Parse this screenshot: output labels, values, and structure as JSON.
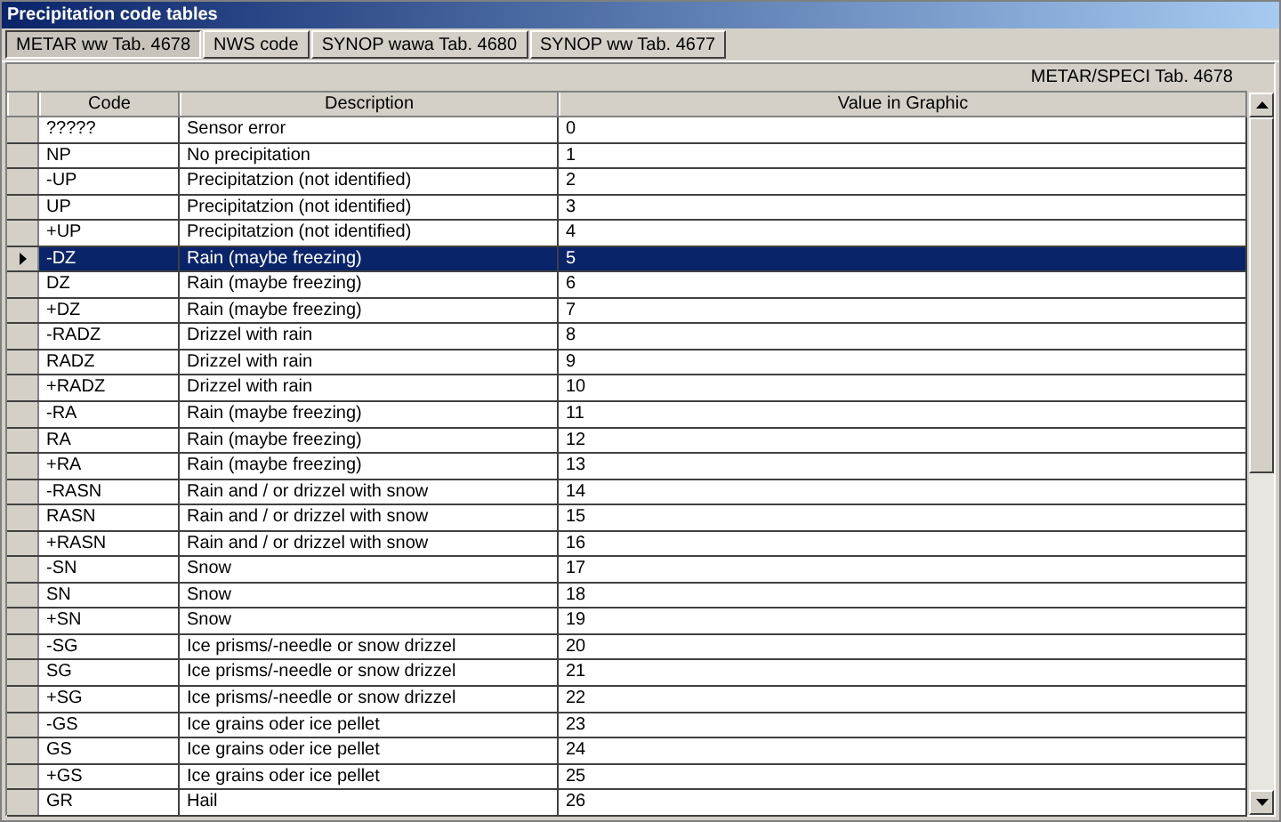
{
  "window": {
    "title": "Precipitation code tables"
  },
  "tabs": [
    {
      "label": "METAR ww Tab. 4678",
      "selected": true
    },
    {
      "label": "NWS code",
      "selected": false
    },
    {
      "label": "SYNOP wawa Tab. 4680",
      "selected": false
    },
    {
      "label": "SYNOP ww Tab. 4677",
      "selected": false
    }
  ],
  "table": {
    "caption": "METAR/SPECI Tab. 4678",
    "columns": [
      "Code",
      "Description",
      "Value in Graphic"
    ],
    "rows": [
      {
        "cells": [
          "?????",
          "Sensor error",
          "0"
        ],
        "selected": false
      },
      {
        "cells": [
          "NP",
          "No precipitation",
          "1"
        ],
        "selected": false
      },
      {
        "cells": [
          "-UP",
          "Precipitatzion (not identified)",
          "2"
        ],
        "selected": false
      },
      {
        "cells": [
          "UP",
          "Precipitatzion (not identified)",
          "3"
        ],
        "selected": false
      },
      {
        "cells": [
          "+UP",
          "Precipitatzion (not identified)",
          "4"
        ],
        "selected": false
      },
      {
        "cells": [
          "-DZ",
          "Rain (maybe freezing)",
          "5"
        ],
        "selected": true
      },
      {
        "cells": [
          "DZ",
          "Rain (maybe freezing)",
          "6"
        ],
        "selected": false
      },
      {
        "cells": [
          "+DZ",
          "Rain (maybe freezing)",
          "7"
        ],
        "selected": false
      },
      {
        "cells": [
          "-RADZ",
          "Drizzel with rain",
          "8"
        ],
        "selected": false
      },
      {
        "cells": [
          "RADZ",
          "Drizzel with rain",
          "9"
        ],
        "selected": false
      },
      {
        "cells": [
          "+RADZ",
          "Drizzel with rain",
          "10"
        ],
        "selected": false
      },
      {
        "cells": [
          "-RA",
          "Rain (maybe freezing)",
          "11"
        ],
        "selected": false
      },
      {
        "cells": [
          "RA",
          "Rain (maybe freezing)",
          "12"
        ],
        "selected": false
      },
      {
        "cells": [
          "+RA",
          "Rain (maybe freezing)",
          "13"
        ],
        "selected": false
      },
      {
        "cells": [
          "-RASN",
          "Rain and / or drizzel with snow",
          "14"
        ],
        "selected": false
      },
      {
        "cells": [
          "RASN",
          "Rain and / or drizzel with snow",
          "15"
        ],
        "selected": false
      },
      {
        "cells": [
          "+RASN",
          "Rain and / or drizzel with snow",
          "16"
        ],
        "selected": false
      },
      {
        "cells": [
          "-SN",
          "Snow",
          "17"
        ],
        "selected": false
      },
      {
        "cells": [
          "SN",
          "Snow",
          "18"
        ],
        "selected": false
      },
      {
        "cells": [
          "+SN",
          "Snow",
          "19"
        ],
        "selected": false
      },
      {
        "cells": [
          "-SG",
          "Ice prisms/-needle or snow drizzel",
          "20"
        ],
        "selected": false
      },
      {
        "cells": [
          "SG",
          "Ice prisms/-needle or snow drizzel",
          "21"
        ],
        "selected": false
      },
      {
        "cells": [
          "+SG",
          "Ice prisms/-needle or snow drizzel",
          "22"
        ],
        "selected": false
      },
      {
        "cells": [
          "-GS",
          "Ice grains oder ice pellet",
          "23"
        ],
        "selected": false
      },
      {
        "cells": [
          "GS",
          "Ice grains oder ice pellet",
          "24"
        ],
        "selected": false
      },
      {
        "cells": [
          "+GS",
          "Ice grains oder ice pellet",
          "25"
        ],
        "selected": false
      },
      {
        "cells": [
          "GR",
          "Hail",
          "26"
        ],
        "selected": false
      }
    ]
  }
}
